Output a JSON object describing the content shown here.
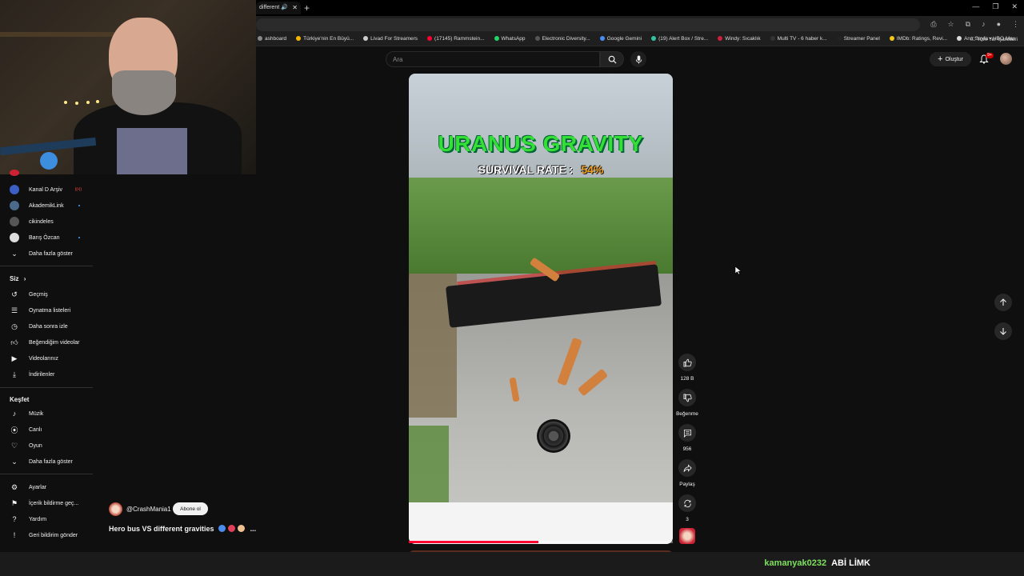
{
  "browser": {
    "tab_title": "different",
    "bookmarks": [
      {
        "label": "ashboard",
        "color": "#888888"
      },
      {
        "label": "Türkiye'nin En Büyü...",
        "color": "#f5b800"
      },
      {
        "label": "Livad For Streamers",
        "color": "#cccccc"
      },
      {
        "label": "(17145) Rammstein...",
        "color": "#ff0033"
      },
      {
        "label": "WhatsApp",
        "color": "#25d366"
      },
      {
        "label": "Electronic Diversity...",
        "color": "#555555"
      },
      {
        "label": "Google Gemini",
        "color": "#4a8df0"
      },
      {
        "label": "(19) Alert Box / Stre...",
        "color": "#31c3a2"
      },
      {
        "label": "Windy: Sıcaklık",
        "color": "#d01f3c"
      },
      {
        "label": "Multi TV - 6 haber k...",
        "color": "#333333"
      },
      {
        "label": "Streamer Panel",
        "color": "#222222"
      },
      {
        "label": "IMDb: Ratings, Revi...",
        "color": "#f5c518"
      },
      {
        "label": "Ana Sayfa • HBO Max",
        "color": "#dddddd"
      }
    ],
    "all_bookmarks_label": "Tüm Yer İşaretleri"
  },
  "topbar": {
    "search_placeholder": "Ara",
    "create_label": "Oluştur",
    "notification_count": "9+"
  },
  "sidebar": {
    "subscriptions": [
      {
        "label": "Kanal D Arşiv",
        "color": "#3b5fc4",
        "indicator": "live"
      },
      {
        "label": "AkademikLink",
        "color": "#4a6a8a",
        "indicator": "dot"
      },
      {
        "label": "cikindeles",
        "color": "#555555",
        "indicator": "none"
      },
      {
        "label": "Barış Özcan",
        "color": "#dddddd",
        "indicator": "dot"
      }
    ],
    "show_more_1": "Daha fazla göster",
    "you_heading": "Siz",
    "you_items": [
      "Geçmiş",
      "Oynatma listeleri",
      "Daha sonra izle",
      "Beğendiğim videolar",
      "Videolarınız",
      "İndirilenler"
    ],
    "explore_heading": "Keşfet",
    "explore_items": [
      "Müzik",
      "Canlı",
      "Oyun"
    ],
    "show_more_2": "Daha fazla göster",
    "footer_items": [
      "Ayarlar",
      "İçerik bildirme geç...",
      "Yardım",
      "Geri bildirim gönder"
    ]
  },
  "short": {
    "overlay_title": "URANUS GRAVITY",
    "survival_label": "SURVIVAL RATE :",
    "survival_value": "54%",
    "progress_fraction": 0.49,
    "channel_handle": "@CrashMania1",
    "subscribe_label": "Abone ol",
    "title": "Hero bus VS different gravities",
    "title_ellipsis": "...",
    "title_emoji_colors": [
      "#4a8df0",
      "#e0405a",
      "#f0c090"
    ]
  },
  "actions": {
    "likes": "128 B",
    "dislike_label": "Beğenme",
    "comments": "956",
    "share_label": "Paylaş",
    "remix_count": "3"
  },
  "chat": {
    "username": "kamanyak0232",
    "message": "ABİ LİMK"
  }
}
